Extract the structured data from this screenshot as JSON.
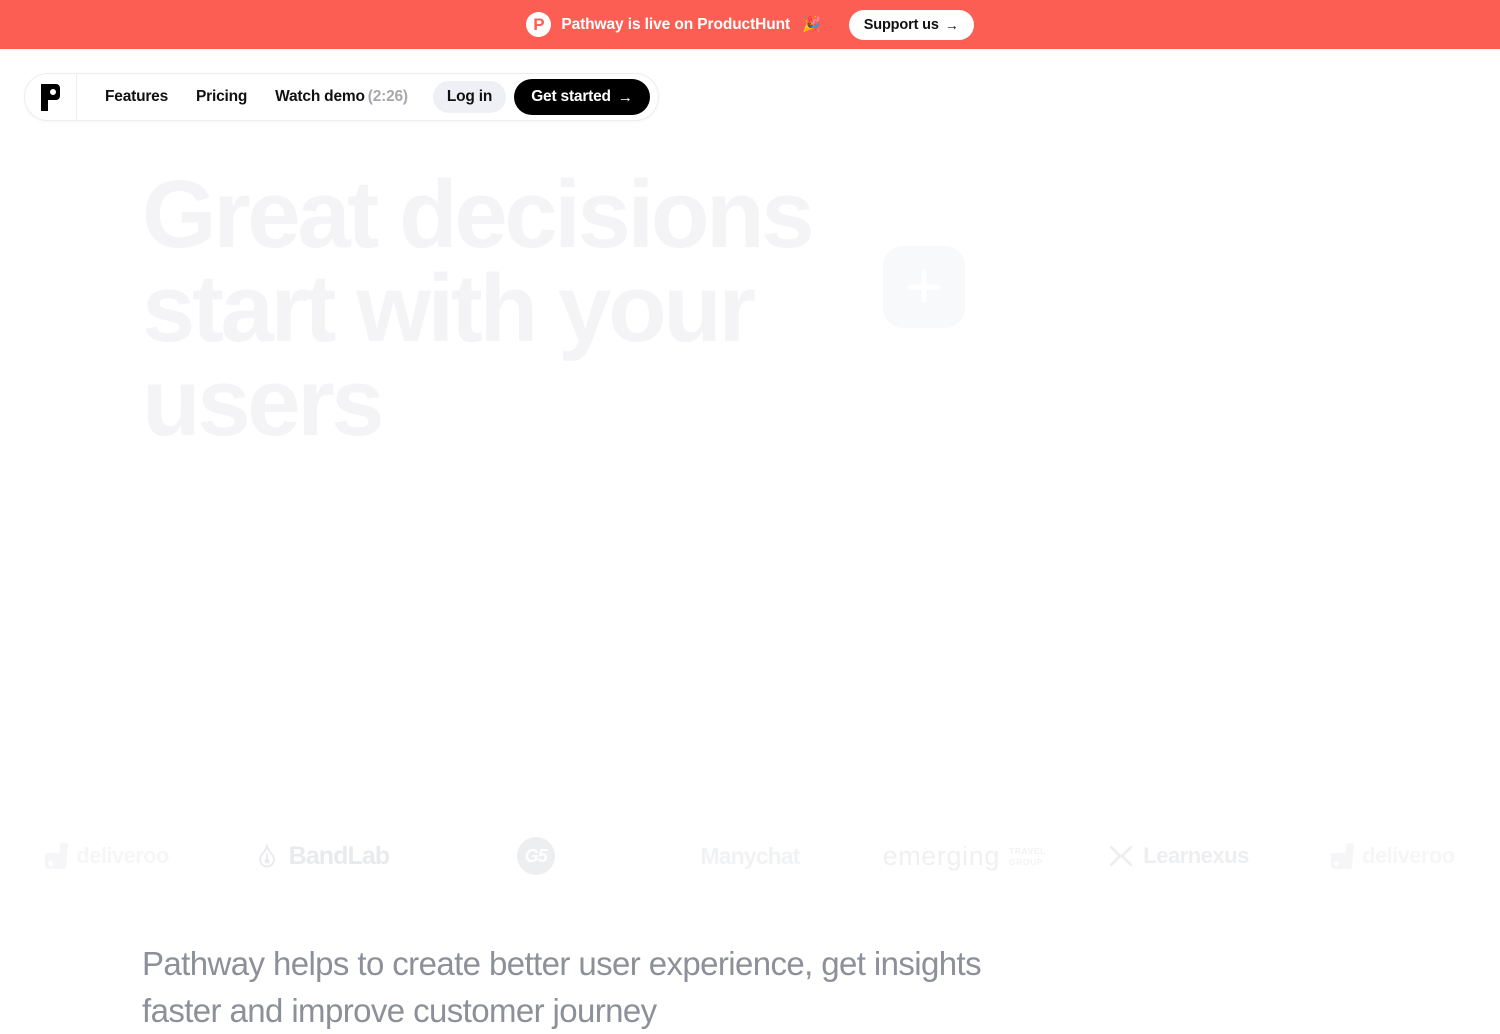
{
  "announcement": {
    "badge_icon": "producthunt-logo-icon",
    "badge_letter": "P",
    "text": "Pathway is live on ProductHunt",
    "emoji": "🎉",
    "support_label": "Support us",
    "support_arrow": "→",
    "background_color": "#FD5E53",
    "text_color": "#FFFFFF"
  },
  "nav": {
    "logo_name": "pathway-logo-icon",
    "links": [
      {
        "label": "Features"
      },
      {
        "label": "Pricing"
      },
      {
        "label": "Watch demo",
        "suffix": "(2:26)"
      }
    ],
    "login_label": "Log in",
    "get_started_label": "Get started",
    "get_started_arrow": "→"
  },
  "hero": {
    "title": "Great decisions start with your users",
    "title_color": "#F4F4F6",
    "plus_icon": "plus-icon"
  },
  "logos": {
    "items": [
      {
        "name": "deliveroo",
        "label": "deliveroo",
        "style": "faded"
      },
      {
        "name": "bandlab",
        "label": "BandLab",
        "style": "normal"
      },
      {
        "name": "g5",
        "label": "G5",
        "style": "normal"
      },
      {
        "name": "manychat",
        "label": "Manychat",
        "style": "normal"
      },
      {
        "name": "emerging-travel-group",
        "label": "emerging",
        "sub_line1": "TRAVEL",
        "sub_line2": "GROUP",
        "style": "normal"
      },
      {
        "name": "learnexus",
        "label": "Learnexus",
        "style": "normal"
      },
      {
        "name": "deliveroo-repeat",
        "label": "deliveroo",
        "style": "faded"
      }
    ]
  },
  "subheading": {
    "text": "Pathway helps to create better user experience, get insights faster and improve customer journey",
    "color": "#8D9099"
  }
}
